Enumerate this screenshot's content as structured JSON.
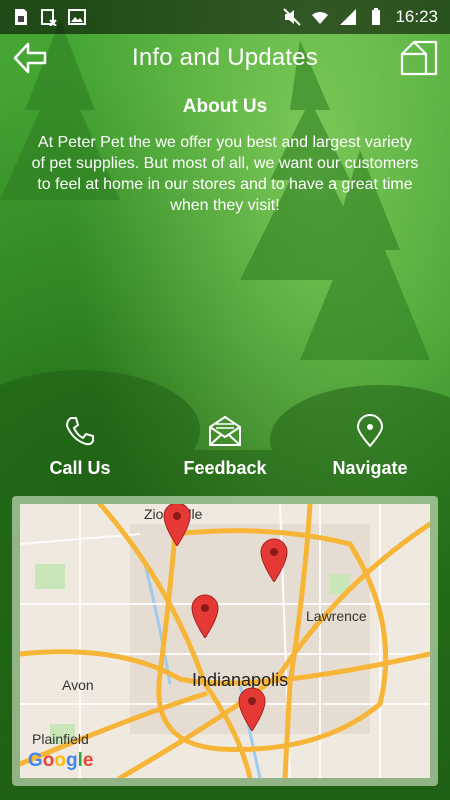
{
  "status_bar": {
    "time": "16:23",
    "battery": "battery-full-icon"
  },
  "app_bar": {
    "title": "Info and Updates",
    "back_icon": "back-arrow-icon",
    "home_icon": "home-icon"
  },
  "about": {
    "title": "About Us",
    "text": "At Peter Pet the we offer you best and largest variety of pet supplies. But most of all, we want our customers to feel at home in our stores and to have a great time when they visit!"
  },
  "actions": [
    {
      "label": "Call Us",
      "icon": "phone-icon"
    },
    {
      "label": "Feedback",
      "icon": "envelope-icon"
    },
    {
      "label": "Navigate",
      "icon": "location-pin-icon"
    }
  ],
  "map": {
    "labels": {
      "zionsville": "Zionsville",
      "lawrence": "Lawrence",
      "indianapolis": "Indianapolis",
      "avon": "Avon",
      "plainfield": "Plainfield"
    },
    "google": [
      "G",
      "o",
      "o",
      "g",
      "l",
      "e"
    ],
    "google_colors": [
      "#4285F4",
      "#EA4335",
      "#FBBC05",
      "#4285F4",
      "#34A853",
      "#EA4335"
    ],
    "marker_color": "#e53935",
    "marker_count": 4
  }
}
